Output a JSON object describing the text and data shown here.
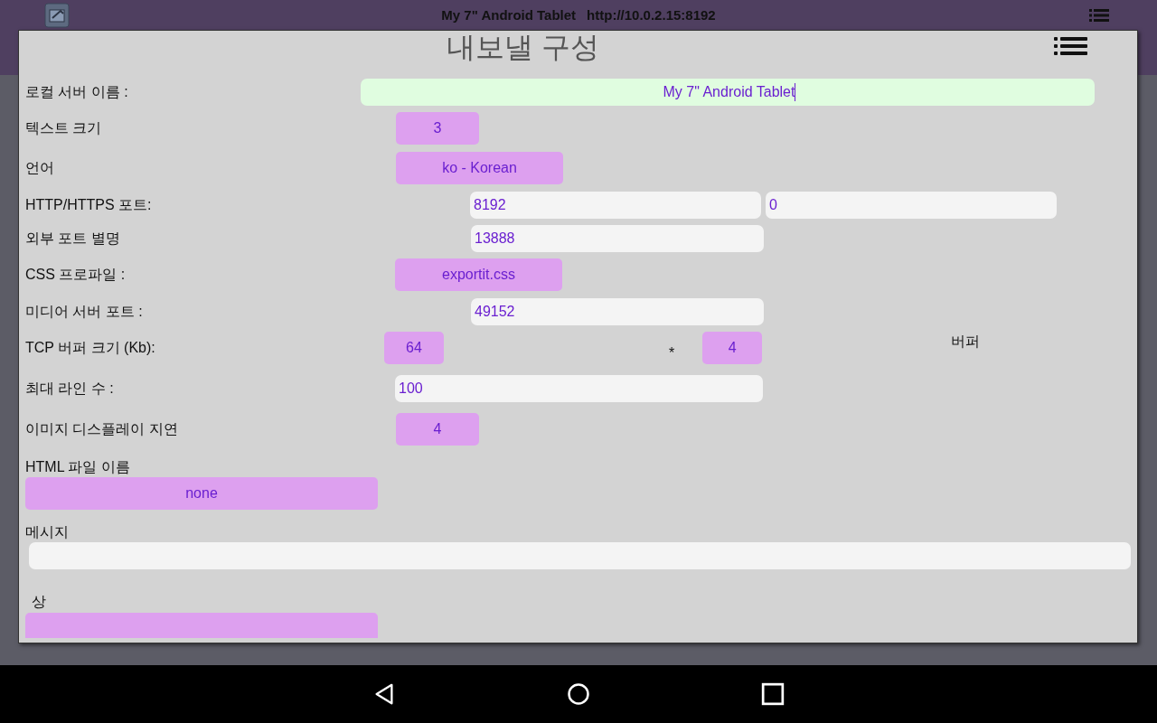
{
  "top_bar": {
    "title": "My 7\" Android Tablet",
    "url": "http://10.0.2.15:8192"
  },
  "dialog": {
    "title": "내보낼 구성",
    "rows": [
      {
        "kind": "inline",
        "label": "로컬 서버 이름 :",
        "controls": [
          {
            "kind": "field",
            "value": "My 7\" Android Tablet",
            "focused": true,
            "highlighted": true
          }
        ]
      },
      {
        "kind": "inline",
        "label": "텍스트 크기",
        "controls": [
          {
            "kind": "button",
            "value": "3"
          }
        ]
      },
      {
        "kind": "inline",
        "label": "언어",
        "controls": [
          {
            "kind": "button",
            "value": "ko - Korean"
          }
        ]
      },
      {
        "kind": "inline",
        "label": "HTTP/HTTPS 포트:",
        "controls": [
          {
            "kind": "field",
            "value": "8192"
          },
          {
            "kind": "field",
            "value": "0"
          }
        ]
      },
      {
        "kind": "inline",
        "label": "외부 포트 별명",
        "controls": [
          {
            "kind": "field",
            "value": "13888"
          }
        ]
      },
      {
        "kind": "inline",
        "label": "CSS 프로파일 :",
        "controls": [
          {
            "kind": "button",
            "value": "exportit.css"
          }
        ]
      },
      {
        "kind": "inline",
        "label": "미디어 서버 포트 :",
        "controls": [
          {
            "kind": "field",
            "value": "49152"
          }
        ]
      },
      {
        "kind": "inline",
        "label": "TCP 버퍼 크기 (Kb):",
        "controls": [
          {
            "kind": "button",
            "value": "64"
          },
          {
            "kind": "text",
            "value": "*"
          },
          {
            "kind": "button",
            "value": "4"
          },
          {
            "kind": "text",
            "value": "버퍼"
          }
        ]
      },
      {
        "kind": "inline",
        "label": "최대 라인 수 :",
        "controls": [
          {
            "kind": "field",
            "value": "100"
          }
        ]
      },
      {
        "kind": "inline",
        "label": "이미지 디스플레이 지연",
        "controls": [
          {
            "kind": "button",
            "value": "4"
          }
        ]
      },
      {
        "kind": "stacked",
        "label": "HTML 파일 이름",
        "controls": [
          {
            "kind": "button",
            "value": "none"
          }
        ]
      },
      {
        "kind": "stacked",
        "label": "메시지",
        "controls": [
          {
            "kind": "field"
          }
        ]
      },
      {
        "kind": "stacked",
        "label": "상",
        "controls": [
          {
            "kind": "button"
          }
        ]
      }
    ]
  }
}
